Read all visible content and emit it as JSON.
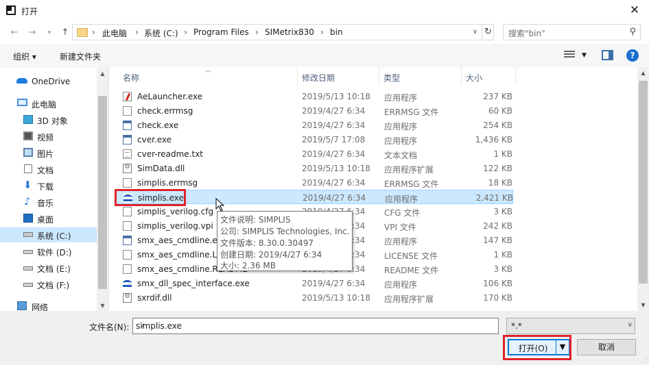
{
  "window": {
    "title": "打开",
    "close_glyph": "✕"
  },
  "nav": {
    "breadcrumb": [
      "此电脑",
      "系统 (C:)",
      "Program Files",
      "SIMetrix830",
      "bin"
    ],
    "separator": "›",
    "search_placeholder": "搜索\"bin\""
  },
  "toolbar": {
    "organize": "组织 ▾",
    "new_folder": "新建文件夹"
  },
  "sidebar": {
    "items": [
      {
        "label": "OneDrive",
        "icon": "cloud-icon"
      },
      {
        "label": "此电脑",
        "icon": "computer-icon"
      },
      {
        "label": "3D 对象",
        "icon": "cube-icon"
      },
      {
        "label": "视频",
        "icon": "video-icon"
      },
      {
        "label": "图片",
        "icon": "picture-icon"
      },
      {
        "label": "文档",
        "icon": "document-icon"
      },
      {
        "label": "下载",
        "icon": "download-icon"
      },
      {
        "label": "音乐",
        "icon": "music-icon"
      },
      {
        "label": "桌面",
        "icon": "desktop-icon"
      },
      {
        "label": "系统 (C:)",
        "icon": "drive-icon"
      },
      {
        "label": "软件 (D:)",
        "icon": "drive-icon"
      },
      {
        "label": "文档 (E:)",
        "icon": "drive-icon"
      },
      {
        "label": "文档 (F:)",
        "icon": "drive-icon"
      },
      {
        "label": "网络",
        "icon": "network-icon"
      }
    ]
  },
  "columns": {
    "name": "名称",
    "date": "修改日期",
    "type": "类型",
    "size": "大小"
  },
  "files": [
    {
      "name": "AeLauncher.exe",
      "date": "2019/5/13 10:18",
      "type": "应用程序",
      "size": "237 KB",
      "icon": "ae"
    },
    {
      "name": "check.errmsg",
      "date": "2019/4/27 6:34",
      "type": "ERRMSG 文件",
      "size": "60 KB",
      "icon": "doc"
    },
    {
      "name": "check.exe",
      "date": "2019/4/27 6:34",
      "type": "应用程序",
      "size": "254 KB",
      "icon": "app"
    },
    {
      "name": "cver.exe",
      "date": "2019/5/7 17:08",
      "type": "应用程序",
      "size": "1,436 KB",
      "icon": "app"
    },
    {
      "name": "cver-readme.txt",
      "date": "2019/4/27 6:34",
      "type": "文本文档",
      "size": "1 KB",
      "icon": "txt"
    },
    {
      "name": "SimData.dll",
      "date": "2019/5/13 10:18",
      "type": "应用程序扩展",
      "size": "122 KB",
      "icon": "dll"
    },
    {
      "name": "simplis.errmsg",
      "date": "2019/4/27 6:34",
      "type": "ERRMSG 文件",
      "size": "18 KB",
      "icon": "doc"
    },
    {
      "name": "simplis.exe",
      "date": "2019/4/27 6:34",
      "type": "应用程序",
      "size": "2,421 KB",
      "icon": "simp"
    },
    {
      "name": "simplis_verilog.cfg",
      "date": "2019/4/27 6:34",
      "type": "CFG 文件",
      "size": "3 KB",
      "icon": "doc"
    },
    {
      "name": "simplis_verilog.vpi",
      "date": "2019/4/27 6:34",
      "type": "VPI 文件",
      "size": "242 KB",
      "icon": "doc"
    },
    {
      "name": "smx_aes_cmdline.exe",
      "date": "2019/4/27 6:34",
      "type": "应用程序",
      "size": "147 KB",
      "icon": "app"
    },
    {
      "name": "smx_aes_cmdline.LIC",
      "date": "2019/4/27 6:34",
      "type": "LICENSE 文件",
      "size": "1 KB",
      "icon": "doc"
    },
    {
      "name": "smx_aes_cmdline.README",
      "date": "2019/4/27 6:34",
      "type": "README 文件",
      "size": "3 KB",
      "icon": "doc"
    },
    {
      "name": "smx_dll_spec_interface.exe",
      "date": "2019/4/27 6:34",
      "type": "应用程序",
      "size": "106 KB",
      "icon": "simp"
    },
    {
      "name": "sxrdif.dll",
      "date": "2019/5/13 10:18",
      "type": "应用程序扩展",
      "size": "170 KB",
      "icon": "dll"
    }
  ],
  "selected_index": 7,
  "tooltip": {
    "lines": [
      "文件说明: SIMPLIS",
      "公司: SIMPLIS Technologies, Inc.",
      "文件版本: 8.30.0.30497",
      "创建日期: 2019/4/27 6:34",
      "大小: 2.36 MB"
    ]
  },
  "bottom": {
    "filename_label": "文件名(N):",
    "filename_value": "simplis.exe",
    "filter_value": "*.*",
    "open_label": "打开(O)",
    "cancel_label": "取消"
  },
  "colors": {
    "selection": "#cce8ff",
    "highlight_box": "#e1222a",
    "accent": "#0078d7"
  }
}
